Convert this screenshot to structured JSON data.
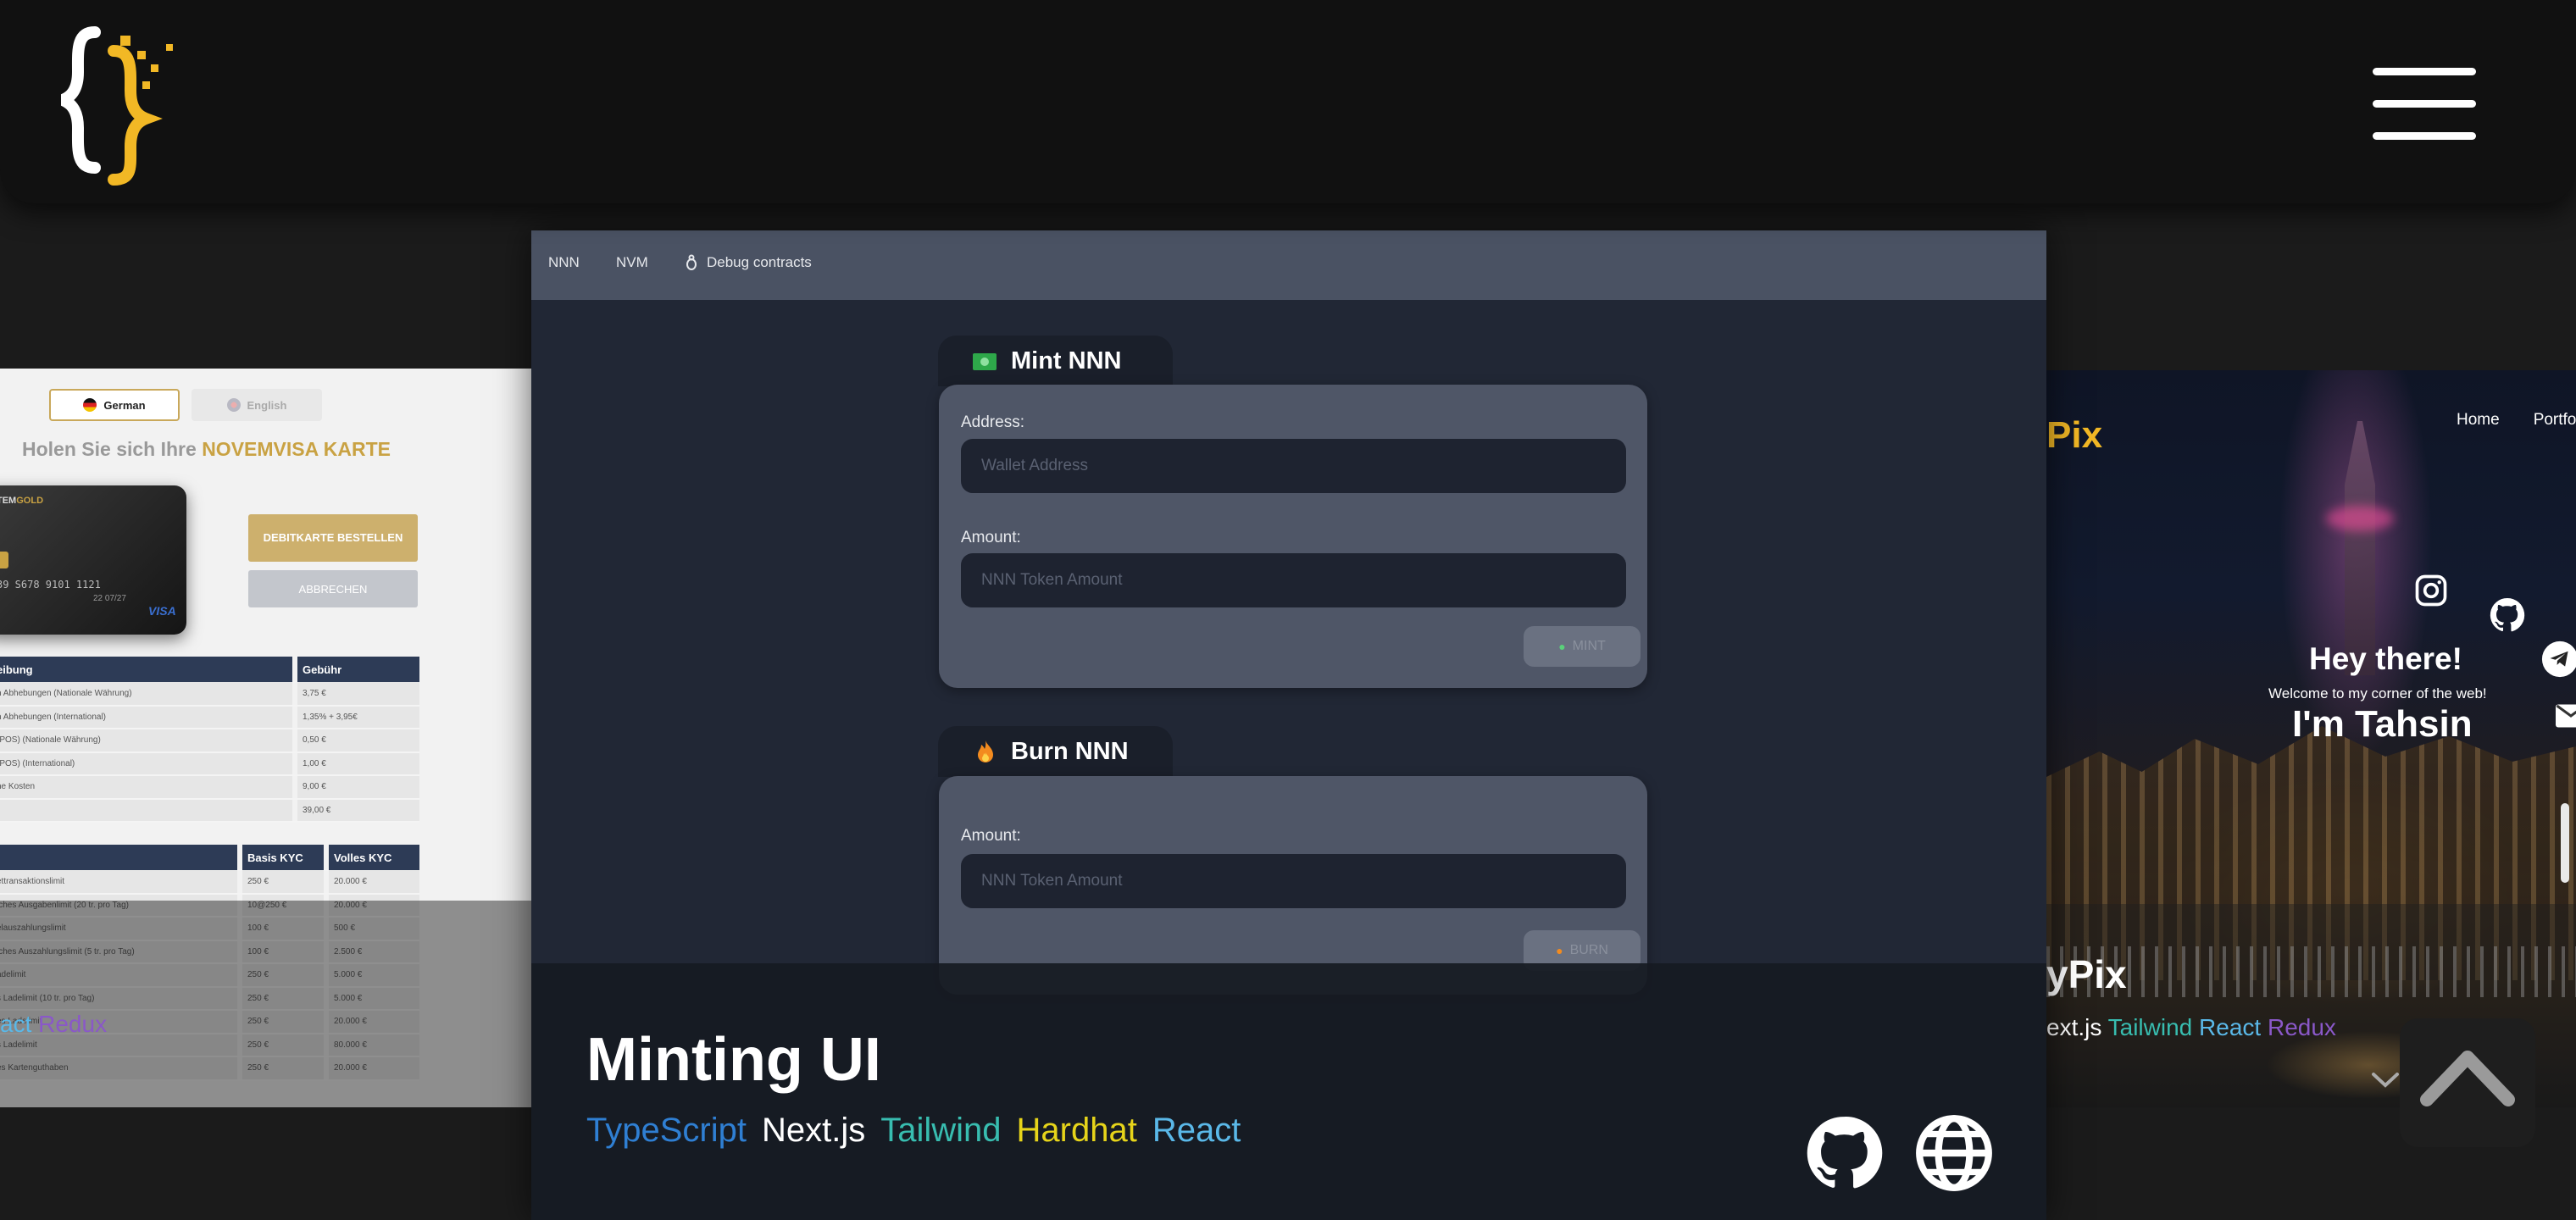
{
  "header": {
    "logo_name": "brace-pixel-logo",
    "menu_icon": "hamburger-menu-icon"
  },
  "colors": {
    "brand_yellow": "#f2b825",
    "typescript": "#2f7fd3",
    "nextjs": "#ffffff",
    "tailwind": "#38bdb0",
    "hardhat": "#e6d41a",
    "react": "#5ab8e8",
    "redux": "#8a58c8"
  },
  "left_card": {
    "lang_german": "German",
    "lang_english": "English",
    "heading_prefix": "Holen Sie sich Ihre",
    "heading_highlight": "NOVEMVISA KARTE",
    "card_brand_prefix": "TEM",
    "card_brand_suffix": "GOLD",
    "card_number": "39 S678 9101 1121",
    "card_expiry": "22 07/27",
    "card_network": "VISA",
    "btn_order": "DEBITKARTE BESTELLEN",
    "btn_cancel": "ABBRECHEN",
    "table1": {
      "headers": [
        "eibung",
        "Gebühr"
      ],
      "rows": [
        [
          "h Abhebungen (Nationale Währung)",
          "3,75 €"
        ],
        [
          "h Abhebungen (International)",
          "1,35% + 3,95€"
        ],
        [
          "(POS) (Nationale Währung)",
          "0,50 €"
        ],
        [
          "(POS) (International)",
          "1,00 €"
        ],
        [
          "he Kosten",
          "9,00 €"
        ],
        [
          "",
          "39,00 €"
        ]
      ]
    },
    "table2": {
      "headers": [
        "",
        "Basis KYC",
        "Volles KYC"
      ],
      "rows": [
        [
          "ettransaktionslimit",
          "250 €",
          "20.000 €"
        ],
        [
          "iches Ausgabenlimit (20 tr. pro Tag)",
          "10@250 €",
          "20.000 €"
        ],
        [
          "elauszahlungslimit",
          "100 €",
          "500 €"
        ],
        [
          "iches Auszahlungslimit (5 tr. pro Tag)",
          "100 €",
          "2.500 €"
        ],
        [
          "adelimit",
          "250 €",
          "5.000 €"
        ],
        [
          "s Ladelimit (10 tr. pro Tag)",
          "250 €",
          "5.000 €"
        ],
        [
          "es Ladelimit",
          "250 €",
          "20.000 €"
        ],
        [
          "s Ladelimit",
          "250 €",
          "80.000 €"
        ],
        [
          "es Kartenguthaben",
          "250 €",
          "20.000 €"
        ]
      ]
    },
    "tags": [
      {
        "label": "act",
        "color": "#5ab8e8"
      },
      {
        "label": "Redux",
        "color": "#8a58c8"
      }
    ]
  },
  "main_card": {
    "nav": [
      "NNN",
      "NVM",
      "Debug contracts"
    ],
    "mint": {
      "title": "Mint NNN",
      "address_label": "Address:",
      "address_placeholder": "Wallet Address",
      "amount_label": "Amount:",
      "amount_placeholder": "NNN Token Amount",
      "button": "MINT"
    },
    "burn": {
      "title": "Burn NNN",
      "amount_label": "Amount:",
      "amount_placeholder": "NNN Token Amount",
      "button": "BURN"
    },
    "title": "Minting UI",
    "tags": [
      {
        "label": "TypeScript",
        "color": "#2f7fd3"
      },
      {
        "label": "Next.js",
        "color": "#ffffff"
      },
      {
        "label": "Tailwind",
        "color": "#38bdb0"
      },
      {
        "label": "Hardhat",
        "color": "#e6d41a"
      },
      {
        "label": "React",
        "color": "#5ab8e8"
      }
    ],
    "github_icon": "github-icon",
    "website_icon": "globe-icon"
  },
  "right_card": {
    "logo": "Pix",
    "nav": [
      "Home",
      "Portfo"
    ],
    "hey": "Hey there!",
    "welcome": "Welcome to my corner of the web!",
    "name": "I'm Tahsin",
    "title": "yPix",
    "tags": [
      {
        "label": "ext.js",
        "color": "#ffffff"
      },
      {
        "label": "Tailwind",
        "color": "#38bdb0"
      },
      {
        "label": "React",
        "color": "#5ab8e8"
      },
      {
        "label": "Redux",
        "color": "#8a58c8"
      }
    ]
  }
}
